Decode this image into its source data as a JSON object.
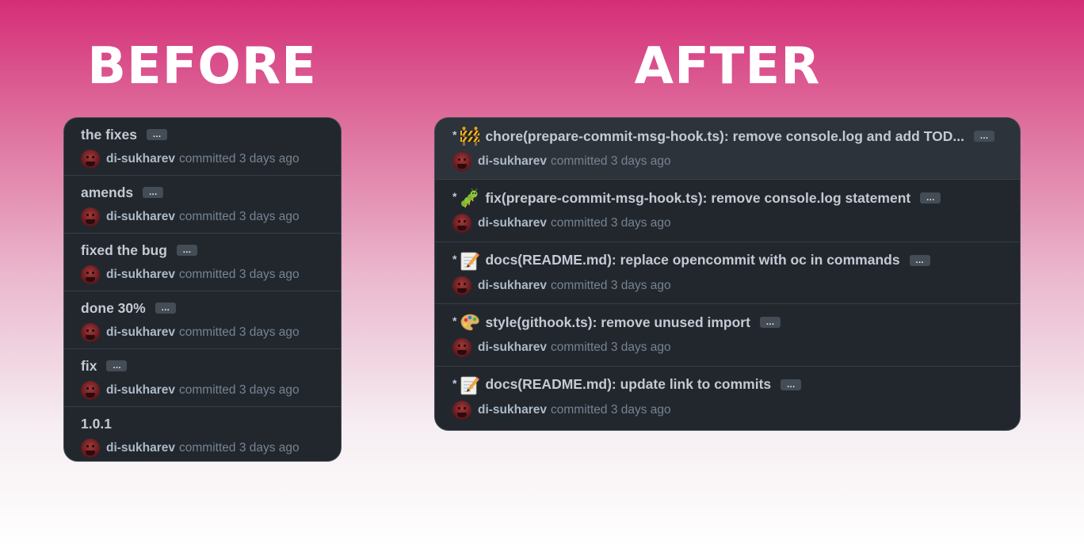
{
  "headings": {
    "before": "BEFORE",
    "after": "AFTER"
  },
  "colors": {
    "panel_bg": "#22272e",
    "highlight_row_bg": "#2d333b",
    "gradient_top": "#d52d77",
    "gradient_bottom": "#ffffff"
  },
  "before_commits": [
    {
      "message": "the fixes",
      "has_ellipsis": true,
      "author": "di-sukharev",
      "committed": "committed 3 days ago"
    },
    {
      "message": "amends",
      "has_ellipsis": true,
      "author": "di-sukharev",
      "committed": "committed 3 days ago"
    },
    {
      "message": "fixed the bug",
      "has_ellipsis": true,
      "author": "di-sukharev",
      "committed": "committed 3 days ago"
    },
    {
      "message": "done 30%",
      "has_ellipsis": true,
      "author": "di-sukharev",
      "committed": "committed 3 days ago"
    },
    {
      "message": "fix",
      "has_ellipsis": true,
      "author": "di-sukharev",
      "committed": "committed 3 days ago"
    },
    {
      "message": "1.0.1",
      "has_ellipsis": false,
      "author": "di-sukharev",
      "committed": "committed 3 days ago"
    }
  ],
  "after_commits": [
    {
      "bullet": "*",
      "emoji": "construction-icon",
      "message": "chore(prepare-commit-msg-hook.ts): remove console.log and add TOD...",
      "author": "di-sukharev",
      "committed": "committed 3 days ago",
      "highlight": true
    },
    {
      "bullet": "*",
      "emoji": "bug-icon",
      "message": "fix(prepare-commit-msg-hook.ts): remove console.log statement",
      "author": "di-sukharev",
      "committed": "committed 3 days ago"
    },
    {
      "bullet": "*",
      "emoji": "memo-icon",
      "message": "docs(README.md): replace opencommit with oc in commands",
      "author": "di-sukharev",
      "committed": "committed 3 days ago"
    },
    {
      "bullet": "*",
      "emoji": "palette-icon",
      "message": "style(githook.ts): remove unused import",
      "author": "di-sukharev",
      "committed": "committed 3 days ago"
    },
    {
      "bullet": "*",
      "emoji": "memo-icon",
      "message": "docs(README.md): update link to commits",
      "author": "di-sukharev",
      "committed": "committed 3 days ago"
    }
  ],
  "ellipsis_label": "…"
}
